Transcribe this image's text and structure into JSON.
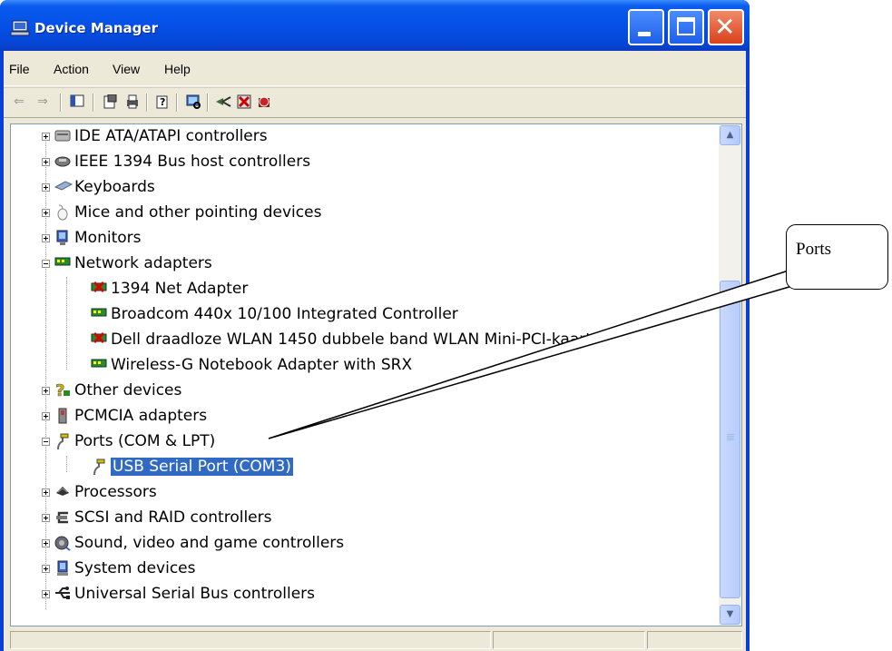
{
  "window": {
    "title": "Device Manager"
  },
  "menu": [
    "File",
    "Action",
    "View",
    "Help"
  ],
  "toolbar": {
    "icons": [
      "back-icon",
      "forward-icon",
      "show-hide-console-tree-icon",
      "properties-icon",
      "print-icon",
      "help-icon",
      "scan-hardware-icon",
      "update-driver-icon",
      "uninstall-icon",
      "disable-icon"
    ]
  },
  "tree": {
    "items": [
      {
        "label": "IDE ATA/ATAPI controllers",
        "level": 0,
        "expander": "plus",
        "icon": "ide-controller-icon"
      },
      {
        "label": "IEEE 1394 Bus host controllers",
        "level": 0,
        "expander": "plus",
        "icon": "ieee1394-icon"
      },
      {
        "label": "Keyboards",
        "level": 0,
        "expander": "plus",
        "icon": "keyboard-icon"
      },
      {
        "label": "Mice and other pointing devices",
        "level": 0,
        "expander": "plus",
        "icon": "mouse-icon"
      },
      {
        "label": "Monitors",
        "level": 0,
        "expander": "plus",
        "icon": "monitor-icon"
      },
      {
        "label": "Network adapters",
        "level": 0,
        "expander": "minus",
        "icon": "network-adapter-icon"
      },
      {
        "label": "1394 Net Adapter",
        "level": 1,
        "icon": "network-adapter-disabled-icon"
      },
      {
        "label": "Broadcom 440x 10/100 Integrated Controller",
        "level": 1,
        "icon": "network-adapter-icon"
      },
      {
        "label": "Dell draadloze WLAN 1450 dubbele band WLAN Mini-PCI-kaart",
        "level": 1,
        "icon": "network-adapter-disabled-icon"
      },
      {
        "label": "Wireless-G Notebook Adapter with SRX",
        "level": 1,
        "icon": "network-adapter-icon"
      },
      {
        "label": "Other devices",
        "level": 0,
        "expander": "plus",
        "icon": "unknown-device-icon"
      },
      {
        "label": "PCMCIA adapters",
        "level": 0,
        "expander": "plus",
        "icon": "pcmcia-icon"
      },
      {
        "label": "Ports (COM & LPT)",
        "level": 0,
        "expander": "minus",
        "icon": "port-icon"
      },
      {
        "label": "USB Serial Port (COM3)",
        "level": 1,
        "icon": "port-icon",
        "selected": true
      },
      {
        "label": "Processors",
        "level": 0,
        "expander": "plus",
        "icon": "processor-icon"
      },
      {
        "label": "SCSI and RAID controllers",
        "level": 0,
        "expander": "plus",
        "icon": "scsi-icon"
      },
      {
        "label": "Sound, video and game controllers",
        "level": 0,
        "expander": "plus",
        "icon": "sound-icon"
      },
      {
        "label": "System devices",
        "level": 0,
        "expander": "plus",
        "icon": "system-device-icon"
      },
      {
        "label": "Universal Serial Bus controllers",
        "level": 0,
        "expander": "plus",
        "icon": "usb-icon"
      }
    ]
  },
  "callout": {
    "text": "Ports"
  },
  "colors": {
    "selection": "#316ac5",
    "titlebar": "#0550e8",
    "chrome": "#ece9d8"
  }
}
